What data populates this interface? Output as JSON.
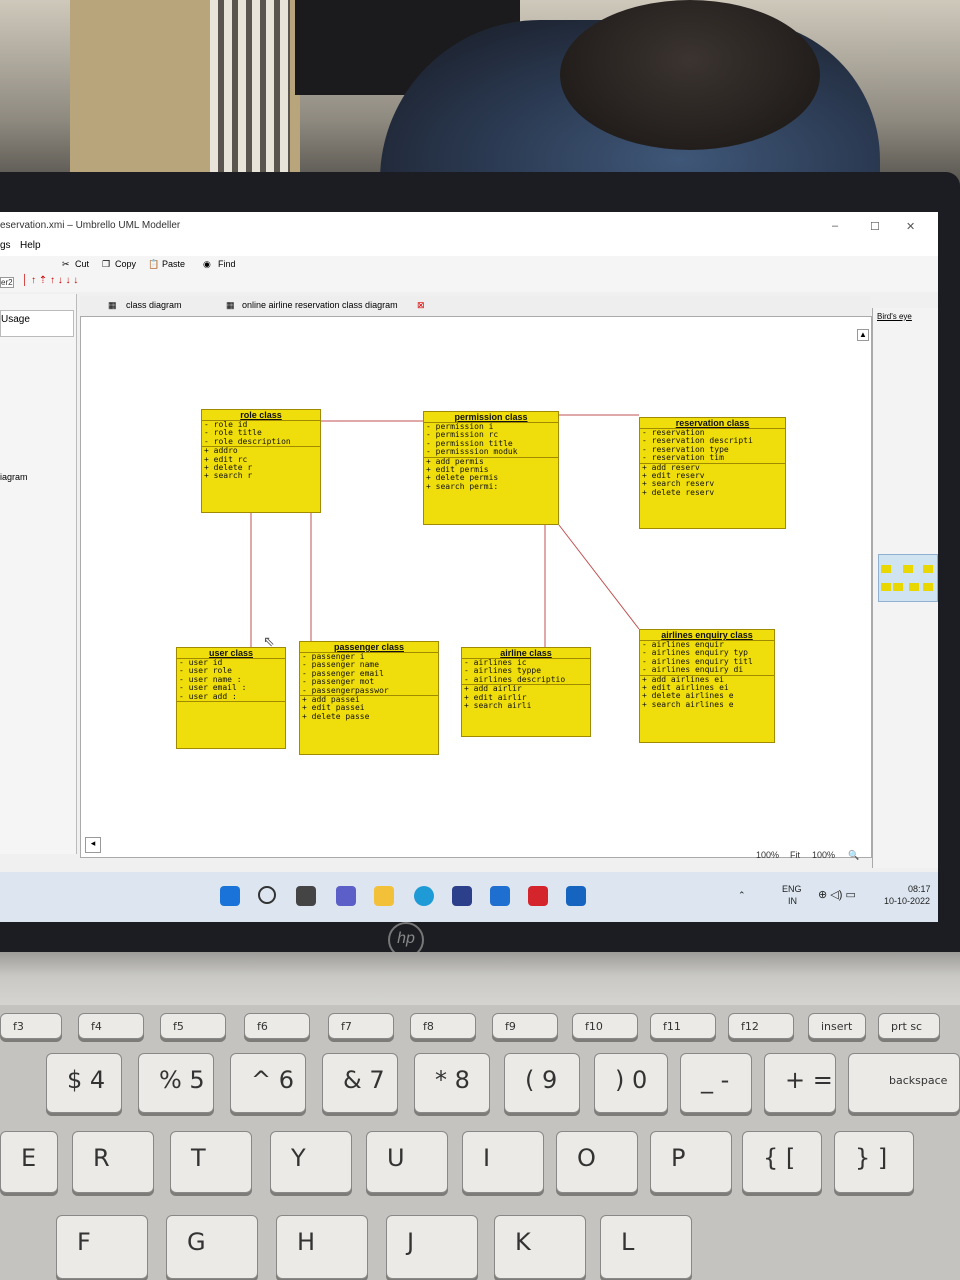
{
  "window": {
    "title": "eservation.xmi – Umbrello UML Modeller",
    "minimize": "–",
    "maximize": "☐",
    "close": "✕"
  },
  "menu": {
    "items": [
      "gs",
      "Help"
    ]
  },
  "toolbar": {
    "cut": "Cut",
    "copy": "Copy",
    "paste": "Paste",
    "find": "Find",
    "left_label": "er2"
  },
  "left_pane": {
    "item1": "Usage",
    "item2": "iagram"
  },
  "tabs": [
    {
      "label": "class diagram"
    },
    {
      "label": "online airline reservation class diagram"
    }
  ],
  "right_pane": {
    "title": "Bird's eye"
  },
  "classes": {
    "role": {
      "title": "role class",
      "attrs": [
        "- role  id",
        "- role title",
        "- role description"
      ],
      "ops": [
        "+ addro",
        "+ edit rc",
        "+ delete r",
        "+ search r"
      ]
    },
    "permission": {
      "title": "permission class",
      "attrs": [
        "- permission i",
        "- permission rc",
        "- permission title",
        "- permisssion moduk"
      ],
      "ops": [
        "+ add permis",
        "+ edit permis",
        "+ delete permis",
        "+ search permi:"
      ]
    },
    "reservation": {
      "title": "reservation class",
      "attrs": [
        "- reservation",
        "- reservation descripti",
        "- reservation type",
        "- reservation tim"
      ],
      "ops": [
        "+ add reserv",
        "+ edit reserv",
        "+ search reserv",
        "+ delete reserv"
      ]
    },
    "user": {
      "title": "user class",
      "attrs": [
        "- user id",
        "- user role",
        "- user name :",
        "- user email :",
        "- user add :"
      ],
      "ops": []
    },
    "passenger": {
      "title": "passenger class",
      "attrs": [
        "- passenger i",
        "- passenger name",
        "- passenger email",
        "- passenger mot",
        "- passengerpasswor"
      ],
      "ops": [
        "+ add passei",
        "+ edit passei",
        "+ delete passe"
      ]
    },
    "airline": {
      "title": "airline class",
      "attrs": [
        "- airlines ic",
        "- airlines typpe",
        "- airlines descriptio"
      ],
      "ops": [
        "+ add airlir",
        "+ edit airlir",
        "+ search airli"
      ]
    },
    "enquiry": {
      "title": "airlines enquiry class",
      "attrs": [
        "- airlines enquir",
        "- airlines enquiry typ",
        "- airlines enquiry titl",
        "- airlines enquiry di"
      ],
      "ops": [
        "+ add airlines ei",
        "+ edit airlines ei",
        "+ delete airlines e",
        "+ search airlines e"
      ]
    }
  },
  "status": {
    "zoom": "100%",
    "fit": "Fit",
    "zoom2": "100%"
  },
  "tray": {
    "lang1": "ENG",
    "lang2": "IN",
    "time": "08:17",
    "date": "10-10-2022"
  },
  "brand": "hp",
  "keys": {
    "row_num": [
      "$ 4",
      "% 5",
      "^ 6",
      "& 7",
      "* 8",
      "( 9",
      ") 0",
      "_ -",
      "+ ="
    ],
    "row_top": [
      "E",
      "R",
      "T",
      "Y",
      "U",
      "I",
      "O",
      "P",
      "{ [",
      "} ]"
    ],
    "row_home": [
      "F",
      "G",
      "H",
      "J",
      "K",
      "L"
    ],
    "fkeys": [
      "f3",
      "f4",
      "f5",
      "f6",
      "f7",
      "f8",
      "f9",
      "f10",
      "f11",
      "f12",
      "insert",
      "prt sc"
    ],
    "backspace": "backspace"
  },
  "colors": {
    "uml_fill": "#f0de0c",
    "link": "#c05050",
    "taskbar": "#dde6f0"
  }
}
